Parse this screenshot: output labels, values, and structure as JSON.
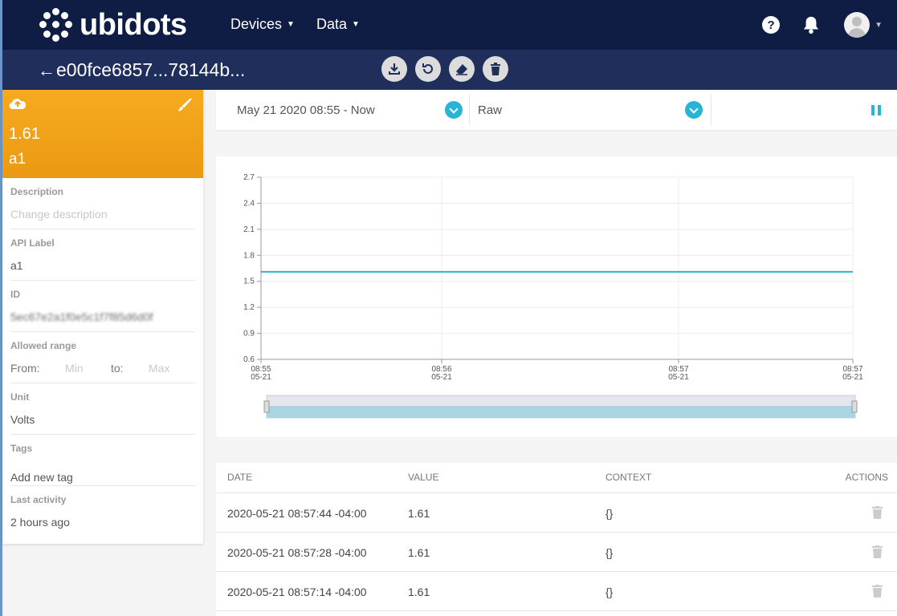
{
  "navbar": {
    "brand": "ubidots",
    "menus": [
      {
        "label": "Devices"
      },
      {
        "label": "Data"
      }
    ],
    "help_glyph": "?"
  },
  "subbar": {
    "device_title": "e00fce6857...78144b...",
    "actions": [
      "download-icon",
      "refresh-icon",
      "eraser-icon",
      "trash-icon"
    ]
  },
  "variable": {
    "value": "1.61",
    "name": "a1",
    "accent_color": "#f4a61d",
    "properties": {
      "description_label": "Description",
      "description_placeholder": "Change description",
      "api_label_label": "API Label",
      "api_label_value": "a1",
      "id_label": "ID",
      "id_value": "5ec67e2a1f0e5c1f7f85d6d0f",
      "range_label": "Allowed range",
      "range_from": "From:",
      "range_min": "Min",
      "range_to": "to:",
      "range_max": "Max",
      "unit_label": "Unit",
      "unit_value": "Volts",
      "tags_label": "Tags",
      "tags_add": "Add new tag",
      "activity_label": "Last activity",
      "activity_value": "2 hours ago"
    }
  },
  "controls": {
    "date_range": "May 21 2020 08:55 - Now",
    "aggregation": "Raw"
  },
  "chart_data": {
    "type": "line",
    "x": [
      "08:55\n05-21",
      "08:56\n05-21",
      "08:57\n05-21",
      "08:57\n05-21"
    ],
    "series": [
      {
        "values": [
          1.61,
          1.61,
          1.61,
          1.61
        ]
      }
    ],
    "y_ticks": [
      "2.7",
      "2.4",
      "2.1",
      "1.8",
      "1.5",
      "1.2",
      "0.9",
      "0.6"
    ],
    "x_ticks": [
      {
        "time": "08:55",
        "date": "05-21"
      },
      {
        "time": "08:56",
        "date": "05-21"
      },
      {
        "time": "08:57",
        "date": "05-21"
      },
      {
        "time": "08:57",
        "date": "05-21"
      }
    ],
    "ylim": [
      0.6,
      2.7
    ],
    "line_color": "#27b4d6",
    "grid": true
  },
  "table": {
    "headers": [
      "DATE",
      "VALUE",
      "CONTEXT",
      "ACTIONS"
    ],
    "rows": [
      {
        "date": "2020-05-21 08:57:44 -04:00",
        "value": "1.61",
        "context": "{}"
      },
      {
        "date": "2020-05-21 08:57:28 -04:00",
        "value": "1.61",
        "context": "{}"
      },
      {
        "date": "2020-05-21 08:57:14 -04:00",
        "value": "1.61",
        "context": "{}"
      }
    ]
  }
}
